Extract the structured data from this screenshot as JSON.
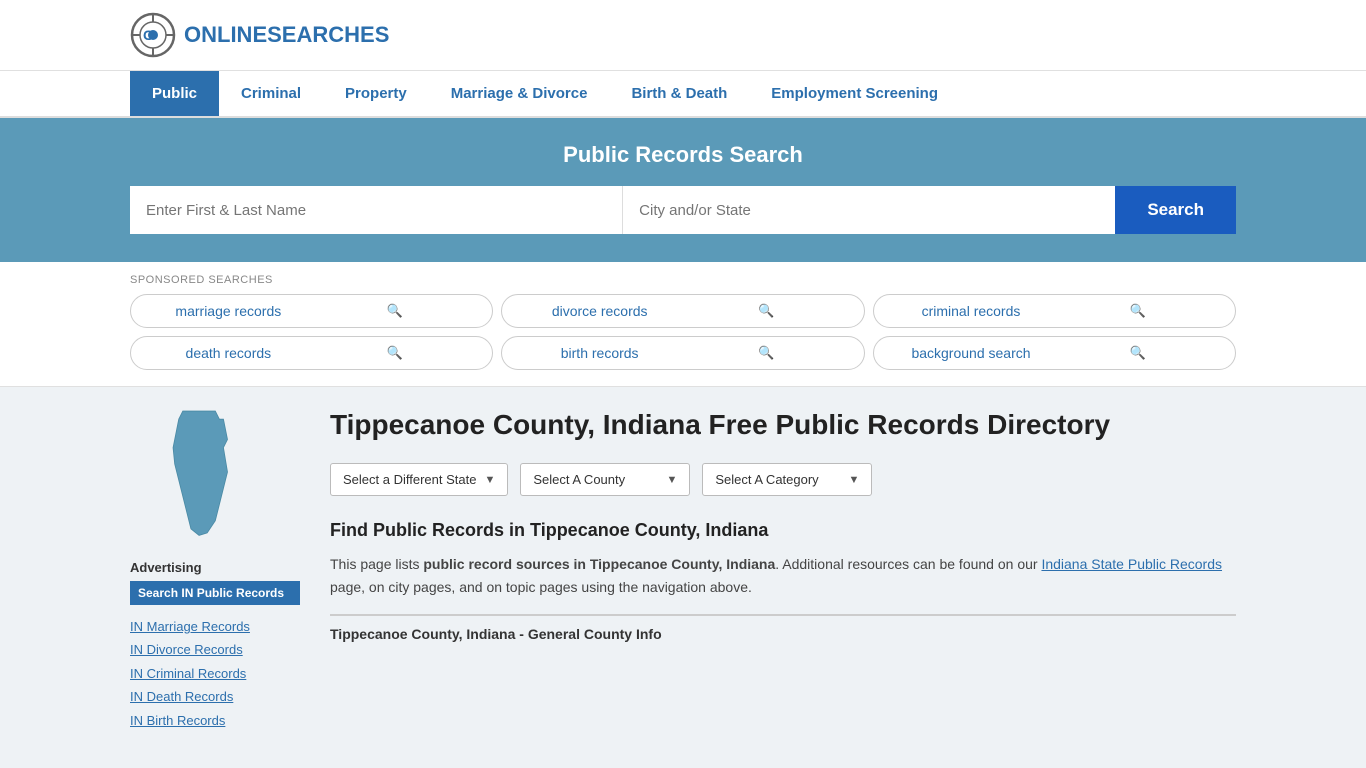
{
  "header": {
    "logo_text_plain": "ONLINE",
    "logo_text_bold": "SEARCHES"
  },
  "nav": {
    "items": [
      {
        "label": "Public",
        "active": true
      },
      {
        "label": "Criminal",
        "active": false
      },
      {
        "label": "Property",
        "active": false
      },
      {
        "label": "Marriage & Divorce",
        "active": false
      },
      {
        "label": "Birth & Death",
        "active": false
      },
      {
        "label": "Employment Screening",
        "active": false
      }
    ]
  },
  "search_hero": {
    "title": "Public Records Search",
    "name_placeholder": "Enter First & Last Name",
    "location_placeholder": "City and/or State",
    "search_button": "Search"
  },
  "sponsored": {
    "label": "SPONSORED SEARCHES",
    "items": [
      "marriage records",
      "divorce records",
      "criminal records",
      "death records",
      "birth records",
      "background search"
    ]
  },
  "page": {
    "title": "Tippecanoe County, Indiana Free Public Records Directory",
    "dropdowns": {
      "state": "Select a Different State",
      "county": "Select A County",
      "category": "Select A Category"
    },
    "find_records_title": "Find Public Records in Tippecanoe County, Indiana",
    "description": "This page lists ",
    "description_bold": "public record sources in Tippecanoe County, Indiana",
    "description_end": ". Additional resources can be found on our ",
    "description_link": "Indiana State Public Records",
    "description_after_link": " page, on city pages, and on topic pages using the navigation above.",
    "general_info": "Tippecanoe County, Indiana - General County Info"
  },
  "sidebar": {
    "advertising_label": "Advertising",
    "ad_banner": "Search IN Public Records",
    "links": [
      "IN Marriage Records",
      "IN Divorce Records",
      "IN Criminal Records",
      "IN Death Records",
      "IN Birth Records"
    ]
  }
}
